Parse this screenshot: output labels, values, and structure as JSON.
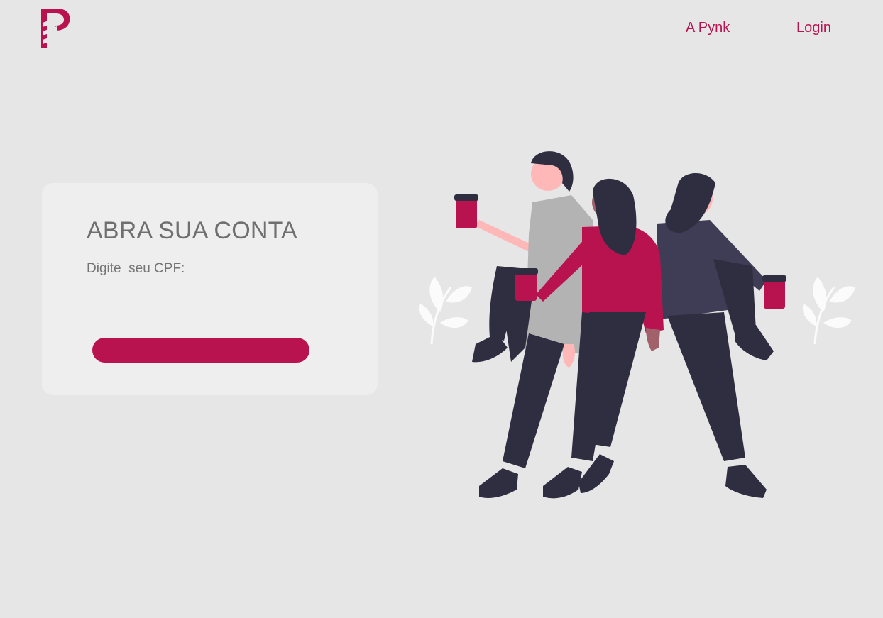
{
  "header": {
    "logo": {
      "icon": "pynk-logo-icon",
      "color": "#b8134f"
    },
    "nav": [
      {
        "label": "A Pynk"
      },
      {
        "label": "Login"
      }
    ]
  },
  "signup_card": {
    "title": "ABRA SUA CONTA",
    "cpf_label": "Digite  seu CPF:",
    "cpf_value": "",
    "submit_label": ""
  },
  "illustration": {
    "icon": "people-with-coffee-illustration"
  },
  "colors": {
    "background": "#e7e6e7",
    "card": "#eeeeee",
    "accent": "#b8134f",
    "dark": "#2f2e41"
  }
}
